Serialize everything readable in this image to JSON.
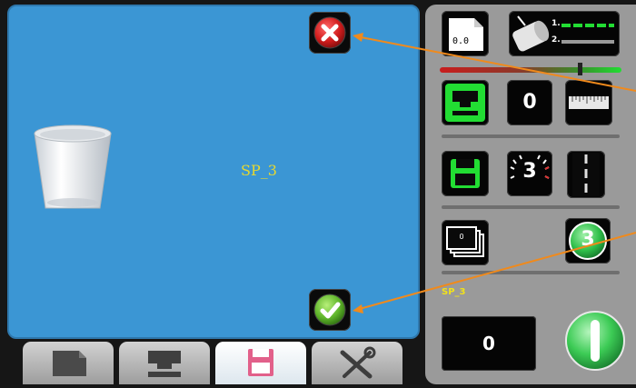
{
  "main": {
    "item_label": "SP_3"
  },
  "side": {
    "counter_display": "0.0",
    "slot_value": "0",
    "count_badge": "3",
    "bottom_value": "0",
    "stack_value": "0",
    "speed_value": "3",
    "label": "SP_3",
    "legend": [
      "1.",
      "2."
    ]
  },
  "colors": {
    "panel_blue": "#3b96d4",
    "active_green": "#22dd33",
    "label_yellow": "#e6d830",
    "accent_orange": "#f08a1c"
  },
  "icons": {
    "cancel": "close-icon",
    "confirm": "check-icon",
    "trash": "trash-bin-icon",
    "power": "power-icon"
  },
  "tabs": [
    {
      "name": "tab-file",
      "icon": "file-icon"
    },
    {
      "name": "tab-tray",
      "icon": "tray-icon"
    },
    {
      "name": "tab-save",
      "icon": "save-icon",
      "active": true
    },
    {
      "name": "tab-tools",
      "icon": "tools-icon"
    }
  ]
}
